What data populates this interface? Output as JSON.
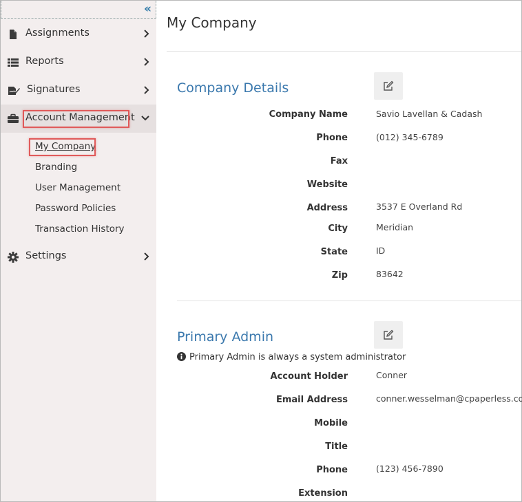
{
  "sidebar": {
    "collapse_icon": "double-chevron-left-icon",
    "items": [
      {
        "label": "Assignments",
        "icon": "file-icon"
      },
      {
        "label": "Reports",
        "icon": "list-icon"
      },
      {
        "label": "Signatures",
        "icon": "signature-icon"
      },
      {
        "label": "Account Management",
        "icon": "briefcase-icon",
        "expanded": true
      },
      {
        "label": "Settings",
        "icon": "gear-icon"
      }
    ],
    "subitems": [
      {
        "label": "My Company",
        "current": true
      },
      {
        "label": "Branding"
      },
      {
        "label": "User Management"
      },
      {
        "label": "Password Policies"
      },
      {
        "label": "Transaction History"
      }
    ]
  },
  "main": {
    "title": "My Company",
    "company_details": {
      "heading": "Company Details",
      "fields": [
        {
          "label": "Company Name",
          "value": "Savio Lavellan & Cadash"
        },
        {
          "label": "Phone",
          "value": "(012) 345-6789"
        },
        {
          "label": "Fax",
          "value": ""
        },
        {
          "label": "Website",
          "value": ""
        },
        {
          "label": "Address",
          "value": "3537 E Overland Rd"
        },
        {
          "label": "City",
          "value": "Meridian"
        },
        {
          "label": "State",
          "value": "ID"
        },
        {
          "label": "Zip",
          "value": "83642"
        }
      ]
    },
    "primary_admin": {
      "heading": "Primary Admin",
      "note": "Primary Admin is always a system administrator",
      "fields": [
        {
          "label": "Account Holder",
          "value": "Conner"
        },
        {
          "label": "Email Address",
          "value": "conner.wesselman@cpaperless.com"
        },
        {
          "label": "Mobile",
          "value": ""
        },
        {
          "label": "Title",
          "value": ""
        },
        {
          "label": "Phone",
          "value": "(123) 456-7890"
        },
        {
          "label": "Extension",
          "value": ""
        }
      ]
    }
  },
  "colors": {
    "sidebar_bg": "#f3eeee",
    "accent": "#3a78ad",
    "highlight": "#e05a5a"
  }
}
